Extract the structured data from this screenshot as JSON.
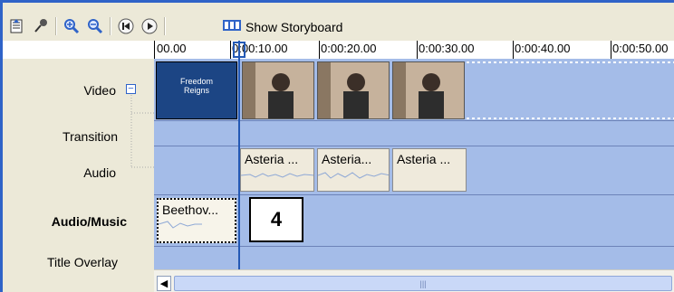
{
  "toolbar": {
    "storyboard_label": "Show Storyboard",
    "icons": [
      "timeline-icon",
      "narrate-icon",
      "zoom-in-icon",
      "zoom-out-icon",
      "rewind-icon",
      "play-icon",
      "storyboard-icon"
    ]
  },
  "ruler": {
    "labels": [
      "00.00",
      "0:00:10.00",
      "0:00:20.00",
      "0:00:30.00",
      "0:00:40.00",
      "0:00:50.00"
    ]
  },
  "tracks": {
    "video": "Video",
    "transition": "Transition",
    "audio": "Audio",
    "audio_music": "Audio/Music",
    "title_overlay": "Title Overlay",
    "collapse_symbol": "−"
  },
  "clips": {
    "title_clip_line1": "Freedom",
    "title_clip_line2": "Reigns",
    "audio_clips": [
      "Asteria ...",
      "Asteria...",
      "Asteria ..."
    ],
    "music_clip": "Beethov..."
  },
  "callout": {
    "number": "4"
  },
  "colors": {
    "accent": "#2f63c8",
    "track_bg": "#a4bce8",
    "toolbar_bg": "#ece9d8",
    "playhead": "#2459b5"
  }
}
